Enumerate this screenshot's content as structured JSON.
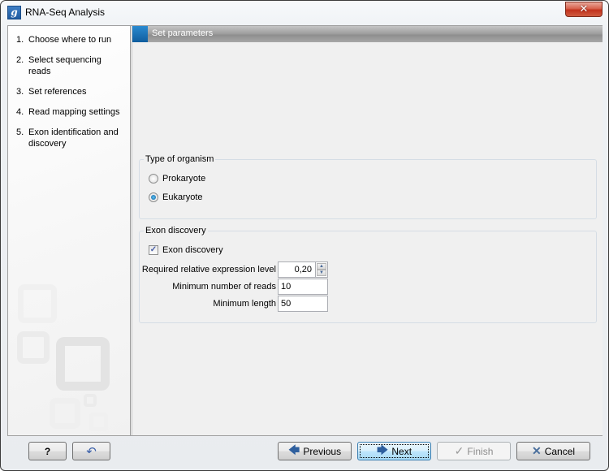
{
  "window": {
    "title": "RNA-Seq Analysis",
    "app_icon": "g",
    "close_glyph": "✕"
  },
  "sidebar": {
    "steps": [
      {
        "num": "1.",
        "label": "Choose where to run"
      },
      {
        "num": "2.",
        "label": "Select sequencing reads"
      },
      {
        "num": "3.",
        "label": "Set references"
      },
      {
        "num": "4.",
        "label": "Read mapping settings"
      },
      {
        "num": "5.",
        "label": "Exon identification and discovery"
      }
    ]
  },
  "content": {
    "header_title": "Set parameters",
    "organism_group": {
      "label": "Type of organism",
      "options": [
        {
          "label": "Prokaryote",
          "checked": false
        },
        {
          "label": "Eukaryote",
          "checked": true
        }
      ]
    },
    "exon_group": {
      "label": "Exon discovery",
      "checkbox": {
        "label": "Exon discovery",
        "checked": true,
        "glyph": "✓"
      },
      "fields": {
        "expression_level": {
          "label": "Required relative expression level",
          "value": "0,20"
        },
        "min_reads": {
          "label": "Minimum number of reads",
          "value": "10"
        },
        "min_length": {
          "label": "Minimum length",
          "value": "50"
        }
      }
    }
  },
  "buttons": {
    "help": {
      "glyph": "?"
    },
    "reset": {
      "glyph": "↶"
    },
    "previous": {
      "label": "Previous",
      "icon": "🡄"
    },
    "next": {
      "label": "Next",
      "icon": "🡆"
    },
    "finish": {
      "label": "Finish",
      "icon": "✓",
      "enabled": false
    },
    "cancel": {
      "label": "Cancel",
      "icon": "✕"
    }
  }
}
